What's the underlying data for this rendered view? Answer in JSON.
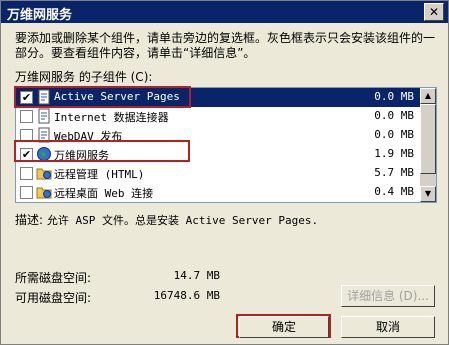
{
  "window": {
    "title": "万维网服务",
    "close_glyph": "✕"
  },
  "description": "要添加或删除某个组件，请单击旁边的复选框。灰色框表示只会安装该组件的一部分。要查看组件内容，请单击“详细信息”。",
  "list_label": "万维网服务 的子组件 (C):",
  "components": [
    {
      "name": "Active Server Pages",
      "size": "0.0 MB",
      "checked": true,
      "selected": true,
      "icon": "document-icon"
    },
    {
      "name": "Internet 数据连接器",
      "size": "0.0 MB",
      "checked": false,
      "selected": false,
      "icon": "document-icon"
    },
    {
      "name": "WebDAV 发布",
      "size": "0.0 MB",
      "checked": false,
      "selected": false,
      "icon": "document-icon"
    },
    {
      "name": "万维网服务",
      "size": "1.9 MB",
      "checked": true,
      "selected": false,
      "icon": "globe-icon"
    },
    {
      "name": "远程管理 (HTML)",
      "size": "5.7 MB",
      "checked": false,
      "selected": false,
      "icon": "folder-globe-icon"
    },
    {
      "name": "远程桌面 Web 连接",
      "size": "0.4 MB",
      "checked": false,
      "selected": false,
      "icon": "folder-globe-icon"
    }
  ],
  "component_description": {
    "label": "描述:",
    "text": "允许 ASP 文件。总是安装 Active Server Pages."
  },
  "disk": {
    "required_label": "所需磁盘空间:",
    "required_value": "14.7 MB",
    "available_label": "可用磁盘空间:",
    "available_value": "16748.6 MB"
  },
  "buttons": {
    "details": "详细信息 (D)...",
    "ok": "确定",
    "cancel": "取消"
  },
  "colors": {
    "selection": "#0a246a",
    "highlight_box": "#b22222",
    "dialog_bg": "#ece9d8"
  }
}
